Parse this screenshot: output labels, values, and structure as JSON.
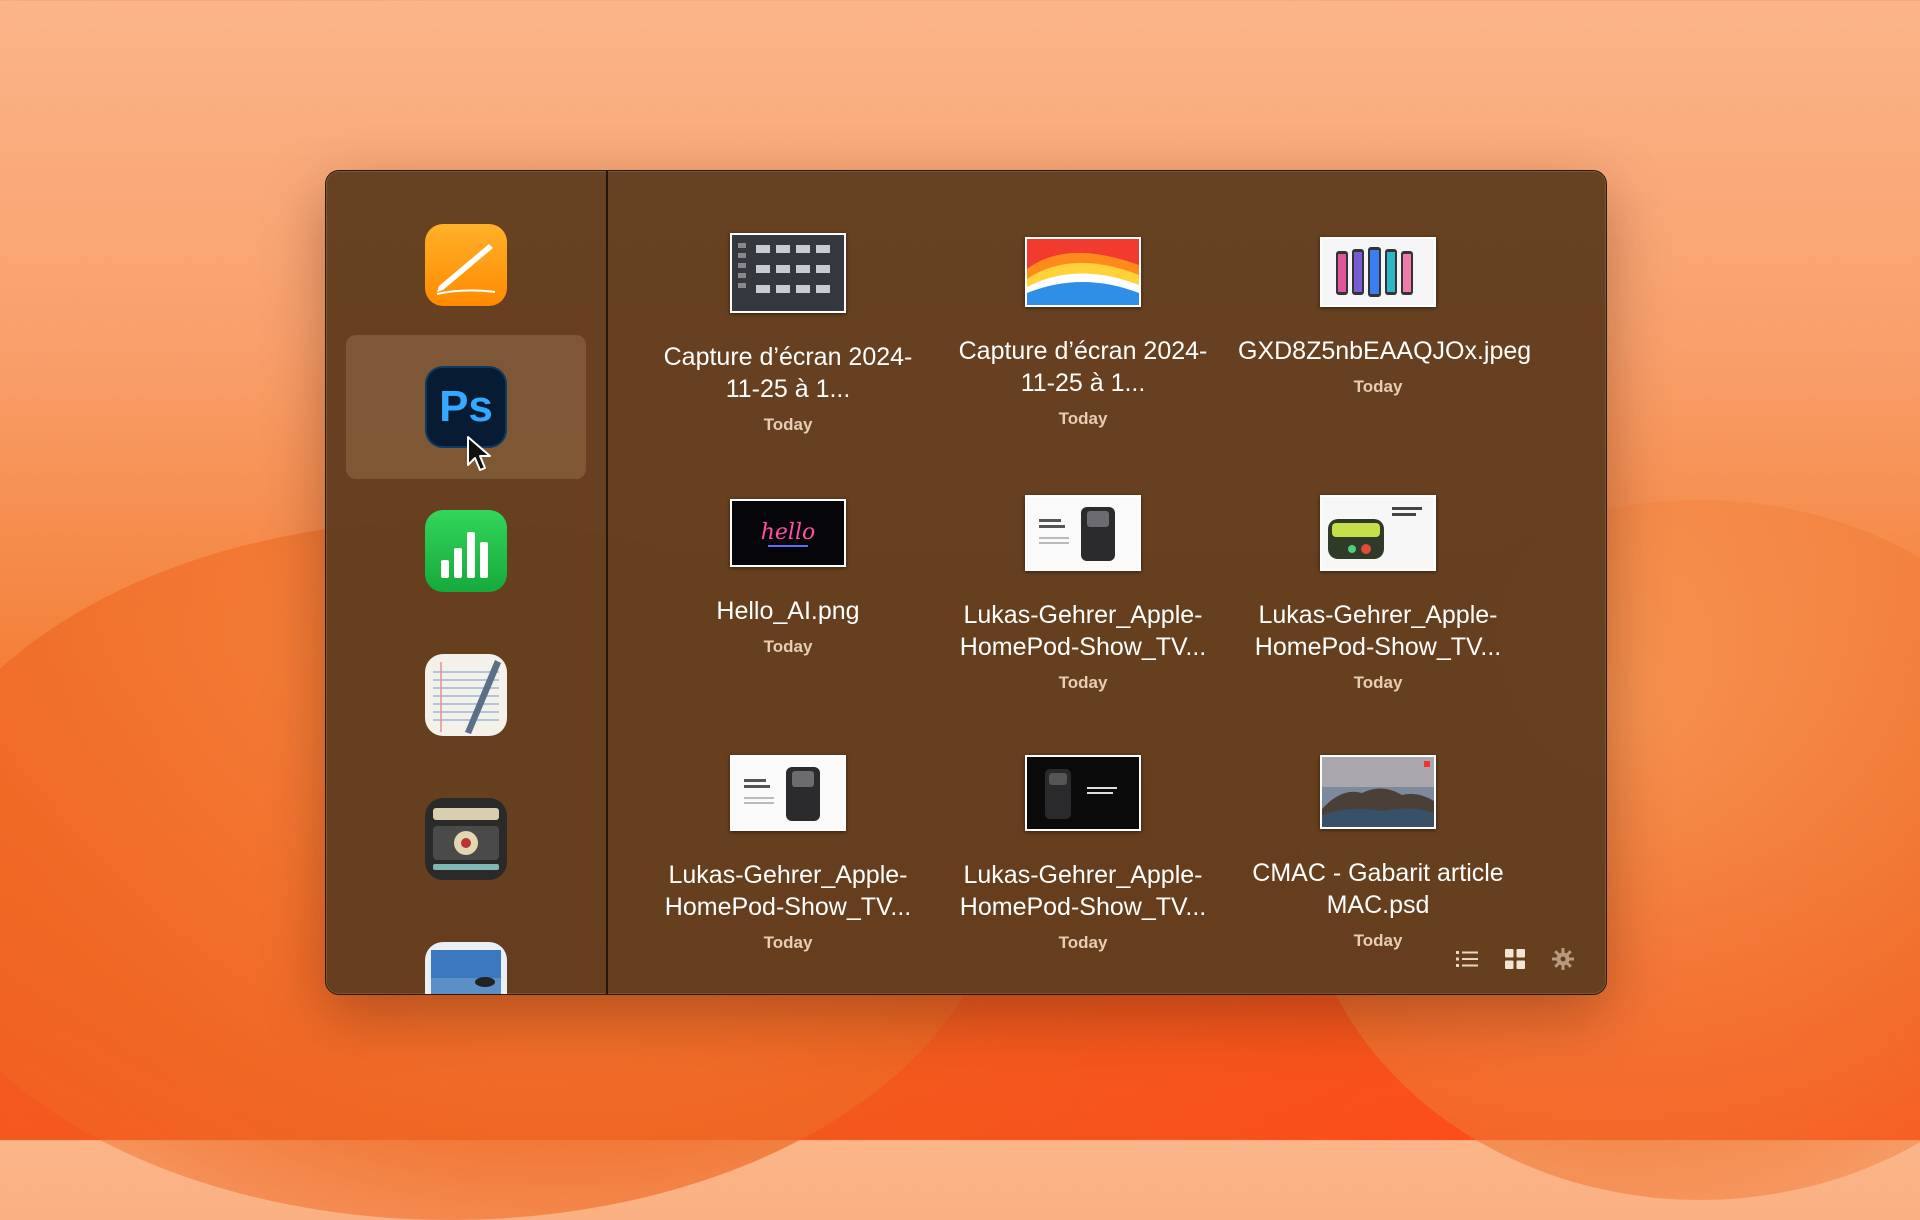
{
  "apps": [
    {
      "name": "Pages",
      "icon": "pages-icon",
      "selected": false
    },
    {
      "name": "Photoshop",
      "icon": "photoshop-icon",
      "selected": true,
      "label": "Ps"
    },
    {
      "name": "Numbers",
      "icon": "numbers-icon",
      "selected": false
    },
    {
      "name": "TextEdit",
      "icon": "textedit-icon",
      "selected": false
    },
    {
      "name": "Voice Recorder",
      "icon": "recorder-icon",
      "selected": false
    },
    {
      "name": "Preview",
      "icon": "preview-icon",
      "selected": false
    }
  ],
  "files": [
    {
      "name": "Capture d’écran 2024-11-25 à 1...",
      "date": "Today",
      "thumb": "screenshot-grid"
    },
    {
      "name": "Capture d’écran 2024-11-25 à 1...",
      "date": "Today",
      "thumb": "gradient-wallpaper"
    },
    {
      "name": "GXD8Z5nbEAAQJOx.jpeg",
      "date": "Today",
      "thumb": "phones"
    },
    {
      "name": "Hello_AI.png",
      "date": "Today",
      "thumb": "hello"
    },
    {
      "name": "Lukas-Gehrer_Apple-HomePod-Show_TV...",
      "date": "Today",
      "thumb": "homepod-white"
    },
    {
      "name": "Lukas-Gehrer_Apple-HomePod-Show_TV...",
      "date": "Today",
      "thumb": "homepod-green"
    },
    {
      "name": "Lukas-Gehrer_Apple-HomePod-Show_TV...",
      "date": "Today",
      "thumb": "homepod-white"
    },
    {
      "name": "Lukas-Gehrer_Apple-HomePod-Show_TV...",
      "date": "Today",
      "thumb": "homepod-dark"
    },
    {
      "name": "CMAC - Gabarit article MAC.psd",
      "date": "Today",
      "thumb": "island"
    }
  ],
  "toolbar": {
    "list_view": "list-view-icon",
    "grid_view": "grid-view-icon",
    "settings": "gear-icon"
  }
}
